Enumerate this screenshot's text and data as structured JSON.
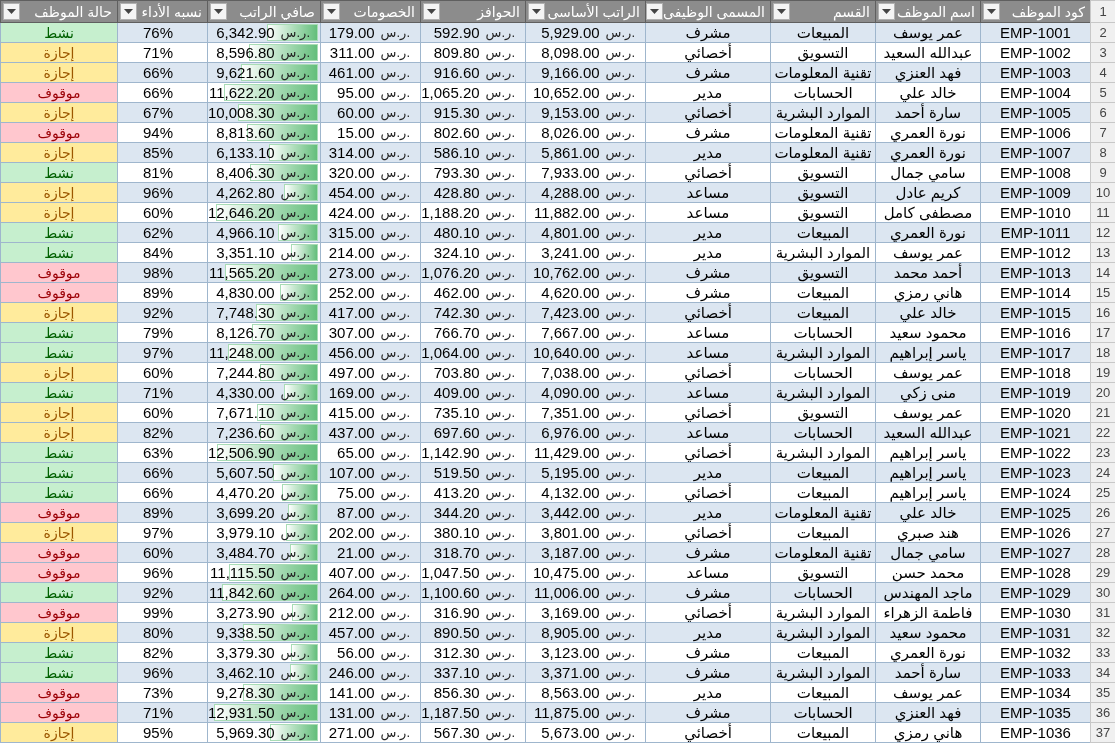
{
  "sheet": {
    "header_row_number": "1",
    "columns": [
      "كود الموظف",
      "اسم الموظف",
      "القسم",
      "المسمى الوظيفى",
      "الراتب الأساسى",
      "الحوافز",
      "الخصومات",
      "صافي الراتب",
      "نسبه الأداء",
      "حالة الموظف"
    ],
    "rows": [
      {
        "row_number": "2",
        "code": "EMP-1001",
        "name": "عمر يوسف",
        "department": "المبيعات",
        "job_title": "مشرف",
        "base_salary": {
          "currency": "ر.س.",
          "amount": "5,929.00"
        },
        "bonus": {
          "currency": "ر.س.",
          "amount": "592.90"
        },
        "deductions": {
          "currency": "ر.س.",
          "amount": "179.00"
        },
        "net_salary": {
          "currency": "ر.س.",
          "amount": "6,342.90",
          "level": 0.49
        },
        "performance": "76%",
        "status": {
          "text": "نشط",
          "color": "#c6efce"
        }
      },
      {
        "row_number": "3",
        "code": "EMP-1002",
        "name": "عبدالله السعيد",
        "department": "التسويق",
        "job_title": "أخصائي",
        "base_salary": {
          "currency": "ر.س.",
          "amount": "8,098.00"
        },
        "bonus": {
          "currency": "ر.س.",
          "amount": "809.80"
        },
        "deductions": {
          "currency": "ر.س.",
          "amount": "311.00"
        },
        "net_salary": {
          "currency": "ر.س.",
          "amount": "8,596.80",
          "level": 0.66
        },
        "performance": "71%",
        "status": {
          "text": "إجازة",
          "color": "#ffeb9c"
        }
      },
      {
        "row_number": "4",
        "code": "EMP-1003",
        "name": "فهد العنزي",
        "department": "تقنية المعلومات",
        "job_title": "مشرف",
        "base_salary": {
          "currency": "ر.س.",
          "amount": "9,166.00"
        },
        "bonus": {
          "currency": "ر.س.",
          "amount": "916.60"
        },
        "deductions": {
          "currency": "ر.س.",
          "amount": "461.00"
        },
        "net_salary": {
          "currency": "ر.س.",
          "amount": "9,621.60",
          "level": 0.74
        },
        "performance": "66%",
        "status": {
          "text": "إجازة",
          "color": "#ffeb9c"
        }
      },
      {
        "row_number": "5",
        "code": "EMP-1004",
        "name": "خالد علي",
        "department": "الحسابات",
        "job_title": "مدير",
        "base_salary": {
          "currency": "ر.س.",
          "amount": "10,652.00"
        },
        "bonus": {
          "currency": "ر.س.",
          "amount": "1,065.20"
        },
        "deductions": {
          "currency": "ر.س.",
          "amount": "95.00"
        },
        "net_salary": {
          "currency": "ر.س.",
          "amount": "11,622.20",
          "level": 0.9
        },
        "performance": "66%",
        "status": {
          "text": "موقوف",
          "color": "#ffc7ce"
        }
      },
      {
        "row_number": "6",
        "code": "EMP-1005",
        "name": "سارة أحمد",
        "department": "الموارد البشرية",
        "job_title": "أخصائي",
        "base_salary": {
          "currency": "ر.س.",
          "amount": "9,153.00"
        },
        "bonus": {
          "currency": "ر.س.",
          "amount": "915.30"
        },
        "deductions": {
          "currency": "ر.س.",
          "amount": "60.00"
        },
        "net_salary": {
          "currency": "ر.س.",
          "amount": "10,008.30",
          "level": 0.77
        },
        "performance": "67%",
        "status": {
          "text": "إجازة",
          "color": "#ffeb9c"
        }
      },
      {
        "row_number": "7",
        "code": "EMP-1006",
        "name": "نورة العمري",
        "department": "تقنية المعلومات",
        "job_title": "مشرف",
        "base_salary": {
          "currency": "ر.س.",
          "amount": "8,026.00"
        },
        "bonus": {
          "currency": "ر.س.",
          "amount": "802.60"
        },
        "deductions": {
          "currency": "ر.س.",
          "amount": "15.00"
        },
        "net_salary": {
          "currency": "ر.س.",
          "amount": "8,813.60",
          "level": 0.68
        },
        "performance": "94%",
        "status": {
          "text": "موقوف",
          "color": "#ffc7ce"
        }
      },
      {
        "row_number": "8",
        "code": "EMP-1007",
        "name": "نورة العمري",
        "department": "تقنية المعلومات",
        "job_title": "مدير",
        "base_salary": {
          "currency": "ر.س.",
          "amount": "5,861.00"
        },
        "bonus": {
          "currency": "ر.س.",
          "amount": "586.10"
        },
        "deductions": {
          "currency": "ر.س.",
          "amount": "314.00"
        },
        "net_salary": {
          "currency": "ر.س.",
          "amount": "6,133.10",
          "level": 0.47
        },
        "performance": "85%",
        "status": {
          "text": "إجازة",
          "color": "#ffeb9c"
        }
      },
      {
        "row_number": "9",
        "code": "EMP-1008",
        "name": "سامي جمال",
        "department": "التسويق",
        "job_title": "أخصائي",
        "base_salary": {
          "currency": "ر.س.",
          "amount": "7,933.00"
        },
        "bonus": {
          "currency": "ر.س.",
          "amount": "793.30"
        },
        "deductions": {
          "currency": "ر.س.",
          "amount": "320.00"
        },
        "net_salary": {
          "currency": "ر.س.",
          "amount": "8,406.30",
          "level": 0.65
        },
        "performance": "81%",
        "status": {
          "text": "نشط",
          "color": "#c6efce"
        }
      },
      {
        "row_number": "10",
        "code": "EMP-1009",
        "name": "كريم عادل",
        "department": "التسويق",
        "job_title": "مساعد",
        "base_salary": {
          "currency": "ر.س.",
          "amount": "4,288.00"
        },
        "bonus": {
          "currency": "ر.س.",
          "amount": "428.80"
        },
        "deductions": {
          "currency": "ر.س.",
          "amount": "454.00"
        },
        "net_salary": {
          "currency": "ر.س.",
          "amount": "4,262.80",
          "level": 0.33
        },
        "performance": "96%",
        "status": {
          "text": "إجازة",
          "color": "#ffeb9c"
        }
      },
      {
        "row_number": "11",
        "code": "EMP-1010",
        "name": "مصطفى كامل",
        "department": "التسويق",
        "job_title": "مساعد",
        "base_salary": {
          "currency": "ر.س.",
          "amount": "11,882.00"
        },
        "bonus": {
          "currency": "ر.س.",
          "amount": "1,188.20"
        },
        "deductions": {
          "currency": "ر.س.",
          "amount": "424.00"
        },
        "net_salary": {
          "currency": "ر.س.",
          "amount": "12,646.20",
          "level": 0.98
        },
        "performance": "60%",
        "status": {
          "text": "إجازة",
          "color": "#ffeb9c"
        }
      },
      {
        "row_number": "12",
        "code": "EMP-1011",
        "name": "نورة العمري",
        "department": "المبيعات",
        "job_title": "مدير",
        "base_salary": {
          "currency": "ر.س.",
          "amount": "4,801.00"
        },
        "bonus": {
          "currency": "ر.س.",
          "amount": "480.10"
        },
        "deductions": {
          "currency": "ر.س.",
          "amount": "315.00"
        },
        "net_salary": {
          "currency": "ر.س.",
          "amount": "4,966.10",
          "level": 0.38
        },
        "performance": "62%",
        "status": {
          "text": "نشط",
          "color": "#c6efce"
        }
      },
      {
        "row_number": "13",
        "code": "EMP-1012",
        "name": "عمر يوسف",
        "department": "الموارد البشرية",
        "job_title": "مدير",
        "base_salary": {
          "currency": "ر.س.",
          "amount": "3,241.00"
        },
        "bonus": {
          "currency": "ر.س.",
          "amount": "324.10"
        },
        "deductions": {
          "currency": "ر.س.",
          "amount": "214.00"
        },
        "net_salary": {
          "currency": "ر.س.",
          "amount": "3,351.10",
          "level": 0.26
        },
        "performance": "84%",
        "status": {
          "text": "نشط",
          "color": "#c6efce"
        }
      },
      {
        "row_number": "14",
        "code": "EMP-1013",
        "name": "أحمد محمد",
        "department": "التسويق",
        "job_title": "مشرف",
        "base_salary": {
          "currency": "ر.س.",
          "amount": "10,762.00"
        },
        "bonus": {
          "currency": "ر.س.",
          "amount": "1,076.20"
        },
        "deductions": {
          "currency": "ر.س.",
          "amount": "273.00"
        },
        "net_salary": {
          "currency": "ر.س.",
          "amount": "11,565.20",
          "level": 0.89
        },
        "performance": "98%",
        "status": {
          "text": "موقوف",
          "color": "#ffc7ce"
        }
      },
      {
        "row_number": "15",
        "code": "EMP-1014",
        "name": "هاني رمزي",
        "department": "المبيعات",
        "job_title": "مشرف",
        "base_salary": {
          "currency": "ر.س.",
          "amount": "4,620.00"
        },
        "bonus": {
          "currency": "ر.س.",
          "amount": "462.00"
        },
        "deductions": {
          "currency": "ر.س.",
          "amount": "252.00"
        },
        "net_salary": {
          "currency": "ر.س.",
          "amount": "4,830.00",
          "level": 0.37
        },
        "performance": "89%",
        "status": {
          "text": "موقوف",
          "color": "#ffc7ce"
        }
      },
      {
        "row_number": "16",
        "code": "EMP-1015",
        "name": "خالد علي",
        "department": "المبيعات",
        "job_title": "أخصائي",
        "base_salary": {
          "currency": "ر.س.",
          "amount": "7,423.00"
        },
        "bonus": {
          "currency": "ر.س.",
          "amount": "742.30"
        },
        "deductions": {
          "currency": "ر.س.",
          "amount": "417.00"
        },
        "net_salary": {
          "currency": "ر.س.",
          "amount": "7,748.30",
          "level": 0.6
        },
        "performance": "92%",
        "status": {
          "text": "إجازة",
          "color": "#ffeb9c"
        }
      },
      {
        "row_number": "17",
        "code": "EMP-1016",
        "name": "محمود سعيد",
        "department": "الحسابات",
        "job_title": "مساعد",
        "base_salary": {
          "currency": "ر.س.",
          "amount": "7,667.00"
        },
        "bonus": {
          "currency": "ر.س.",
          "amount": "766.70"
        },
        "deductions": {
          "currency": "ر.س.",
          "amount": "307.00"
        },
        "net_salary": {
          "currency": "ر.س.",
          "amount": "8,126.70",
          "level": 0.63
        },
        "performance": "79%",
        "status": {
          "text": "نشط",
          "color": "#c6efce"
        }
      },
      {
        "row_number": "18",
        "code": "EMP-1017",
        "name": "ياسر إبراهيم",
        "department": "الموارد البشرية",
        "job_title": "مساعد",
        "base_salary": {
          "currency": "ر.س.",
          "amount": "10,640.00"
        },
        "bonus": {
          "currency": "ر.س.",
          "amount": "1,064.00"
        },
        "deductions": {
          "currency": "ر.س.",
          "amount": "456.00"
        },
        "net_salary": {
          "currency": "ر.س.",
          "amount": "11,248.00",
          "level": 0.87
        },
        "performance": "97%",
        "status": {
          "text": "نشط",
          "color": "#c6efce"
        }
      },
      {
        "row_number": "19",
        "code": "EMP-1018",
        "name": "عمر يوسف",
        "department": "الحسابات",
        "job_title": "أخصائي",
        "base_salary": {
          "currency": "ر.س.",
          "amount": "7,038.00"
        },
        "bonus": {
          "currency": "ر.س.",
          "amount": "703.80"
        },
        "deductions": {
          "currency": "ر.س.",
          "amount": "497.00"
        },
        "net_salary": {
          "currency": "ر.س.",
          "amount": "7,244.80",
          "level": 0.56
        },
        "performance": "60%",
        "status": {
          "text": "إجازة",
          "color": "#ffeb9c"
        }
      },
      {
        "row_number": "20",
        "code": "EMP-1019",
        "name": "منى زكي",
        "department": "الموارد البشرية",
        "job_title": "مساعد",
        "base_salary": {
          "currency": "ر.س.",
          "amount": "4,090.00"
        },
        "bonus": {
          "currency": "ر.س.",
          "amount": "409.00"
        },
        "deductions": {
          "currency": "ر.س.",
          "amount": "169.00"
        },
        "net_salary": {
          "currency": "ر.س.",
          "amount": "4,330.00",
          "level": 0.33
        },
        "performance": "71%",
        "status": {
          "text": "نشط",
          "color": "#c6efce"
        }
      },
      {
        "row_number": "21",
        "code": "EMP-1020",
        "name": "عمر يوسف",
        "department": "التسويق",
        "job_title": "أخصائي",
        "base_salary": {
          "currency": "ر.س.",
          "amount": "7,351.00"
        },
        "bonus": {
          "currency": "ر.س.",
          "amount": "735.10"
        },
        "deductions": {
          "currency": "ر.س.",
          "amount": "415.00"
        },
        "net_salary": {
          "currency": "ر.س.",
          "amount": "7,671.10",
          "level": 0.59
        },
        "performance": "60%",
        "status": {
          "text": "إجازة",
          "color": "#ffeb9c"
        }
      },
      {
        "row_number": "22",
        "code": "EMP-1021",
        "name": "عبدالله السعيد",
        "department": "الحسابات",
        "job_title": "مساعد",
        "base_salary": {
          "currency": "ر.س.",
          "amount": "6,976.00"
        },
        "bonus": {
          "currency": "ر.س.",
          "amount": "697.60"
        },
        "deductions": {
          "currency": "ر.س.",
          "amount": "437.00"
        },
        "net_salary": {
          "currency": "ر.س.",
          "amount": "7,236.60",
          "level": 0.56
        },
        "performance": "82%",
        "status": {
          "text": "إجازة",
          "color": "#ffeb9c"
        }
      },
      {
        "row_number": "23",
        "code": "EMP-1022",
        "name": "ياسر إبراهيم",
        "department": "الموارد البشرية",
        "job_title": "أخصائي",
        "base_salary": {
          "currency": "ر.س.",
          "amount": "11,429.00"
        },
        "bonus": {
          "currency": "ر.س.",
          "amount": "1,142.90"
        },
        "deductions": {
          "currency": "ر.س.",
          "amount": "65.00"
        },
        "net_salary": {
          "currency": "ر.س.",
          "amount": "12,506.90",
          "level": 0.97
        },
        "performance": "63%",
        "status": {
          "text": "نشط",
          "color": "#c6efce"
        }
      },
      {
        "row_number": "24",
        "code": "EMP-1023",
        "name": "ياسر إبراهيم",
        "department": "المبيعات",
        "job_title": "مدير",
        "base_salary": {
          "currency": "ر.س.",
          "amount": "5,195.00"
        },
        "bonus": {
          "currency": "ر.س.",
          "amount": "519.50"
        },
        "deductions": {
          "currency": "ر.س.",
          "amount": "107.00"
        },
        "net_salary": {
          "currency": "ر.س.",
          "amount": "5,607.50",
          "level": 0.43
        },
        "performance": "66%",
        "status": {
          "text": "نشط",
          "color": "#c6efce"
        }
      },
      {
        "row_number": "25",
        "code": "EMP-1024",
        "name": "ياسر إبراهيم",
        "department": "المبيعات",
        "job_title": "أخصائي",
        "base_salary": {
          "currency": "ر.س.",
          "amount": "4,132.00"
        },
        "bonus": {
          "currency": "ر.س.",
          "amount": "413.20"
        },
        "deductions": {
          "currency": "ر.س.",
          "amount": "75.00"
        },
        "net_salary": {
          "currency": "ر.س.",
          "amount": "4,470.20",
          "level": 0.35
        },
        "performance": "66%",
        "status": {
          "text": "نشط",
          "color": "#c6efce"
        }
      },
      {
        "row_number": "26",
        "code": "EMP-1025",
        "name": "خالد علي",
        "department": "تقنية المعلومات",
        "job_title": "مدير",
        "base_salary": {
          "currency": "ر.س.",
          "amount": "3,442.00"
        },
        "bonus": {
          "currency": "ر.س.",
          "amount": "344.20"
        },
        "deductions": {
          "currency": "ر.س.",
          "amount": "87.00"
        },
        "net_salary": {
          "currency": "ر.س.",
          "amount": "3,699.20",
          "level": 0.29
        },
        "performance": "89%",
        "status": {
          "text": "موقوف",
          "color": "#ffc7ce"
        }
      },
      {
        "row_number": "27",
        "code": "EMP-1026",
        "name": "هند صبري",
        "department": "المبيعات",
        "job_title": "أخصائي",
        "base_salary": {
          "currency": "ر.س.",
          "amount": "3,801.00"
        },
        "bonus": {
          "currency": "ر.س.",
          "amount": "380.10"
        },
        "deductions": {
          "currency": "ر.س.",
          "amount": "202.00"
        },
        "net_salary": {
          "currency": "ر.س.",
          "amount": "3,979.10",
          "level": 0.31
        },
        "performance": "97%",
        "status": {
          "text": "إجازة",
          "color": "#ffeb9c"
        }
      },
      {
        "row_number": "28",
        "code": "EMP-1027",
        "name": "سامي جمال",
        "department": "تقنية المعلومات",
        "job_title": "مشرف",
        "base_salary": {
          "currency": "ر.س.",
          "amount": "3,187.00"
        },
        "bonus": {
          "currency": "ر.س.",
          "amount": "318.70"
        },
        "deductions": {
          "currency": "ر.س.",
          "amount": "21.00"
        },
        "net_salary": {
          "currency": "ر.س.",
          "amount": "3,484.70",
          "level": 0.27
        },
        "performance": "60%",
        "status": {
          "text": "موقوف",
          "color": "#ffc7ce"
        }
      },
      {
        "row_number": "29",
        "code": "EMP-1028",
        "name": "محمد حسن",
        "department": "التسويق",
        "job_title": "مساعد",
        "base_salary": {
          "currency": "ر.س.",
          "amount": "10,475.00"
        },
        "bonus": {
          "currency": "ر.س.",
          "amount": "1,047.50"
        },
        "deductions": {
          "currency": "ر.س.",
          "amount": "407.00"
        },
        "net_salary": {
          "currency": "ر.س.",
          "amount": "11,115.50",
          "level": 0.86
        },
        "performance": "96%",
        "status": {
          "text": "موقوف",
          "color": "#ffc7ce"
        }
      },
      {
        "row_number": "30",
        "code": "EMP-1029",
        "name": "ماجد المهندس",
        "department": "الحسابات",
        "job_title": "مشرف",
        "base_salary": {
          "currency": "ر.س.",
          "amount": "11,006.00"
        },
        "bonus": {
          "currency": "ر.س.",
          "amount": "1,100.60"
        },
        "deductions": {
          "currency": "ر.س.",
          "amount": "264.00"
        },
        "net_salary": {
          "currency": "ر.س.",
          "amount": "11,842.60",
          "level": 0.92
        },
        "performance": "92%",
        "status": {
          "text": "نشط",
          "color": "#c6efce"
        }
      },
      {
        "row_number": "31",
        "code": "EMP-1030",
        "name": "فاطمة الزهراء",
        "department": "الموارد البشرية",
        "job_title": "أخصائي",
        "base_salary": {
          "currency": "ر.س.",
          "amount": "3,169.00"
        },
        "bonus": {
          "currency": "ر.س.",
          "amount": "316.90"
        },
        "deductions": {
          "currency": "ر.س.",
          "amount": "212.00"
        },
        "net_salary": {
          "currency": "ر.س.",
          "amount": "3,273.90",
          "level": 0.25
        },
        "performance": "99%",
        "status": {
          "text": "موقوف",
          "color": "#ffc7ce"
        }
      },
      {
        "row_number": "32",
        "code": "EMP-1031",
        "name": "محمود سعيد",
        "department": "الموارد البشرية",
        "job_title": "مدير",
        "base_salary": {
          "currency": "ر.س.",
          "amount": "8,905.00"
        },
        "bonus": {
          "currency": "ر.س.",
          "amount": "890.50"
        },
        "deductions": {
          "currency": "ر.س.",
          "amount": "457.00"
        },
        "net_salary": {
          "currency": "ر.س.",
          "amount": "9,338.50",
          "level": 0.72
        },
        "performance": "80%",
        "status": {
          "text": "إجازة",
          "color": "#ffeb9c"
        }
      },
      {
        "row_number": "33",
        "code": "EMP-1032",
        "name": "نورة العمري",
        "department": "المبيعات",
        "job_title": "مشرف",
        "base_salary": {
          "currency": "ر.س.",
          "amount": "3,123.00"
        },
        "bonus": {
          "currency": "ر.س.",
          "amount": "312.30"
        },
        "deductions": {
          "currency": "ر.س.",
          "amount": "56.00"
        },
        "net_salary": {
          "currency": "ر.س.",
          "amount": "3,379.30",
          "level": 0.26
        },
        "performance": "82%",
        "status": {
          "text": "نشط",
          "color": "#c6efce"
        }
      },
      {
        "row_number": "34",
        "code": "EMP-1033",
        "name": "سارة أحمد",
        "department": "الموارد البشرية",
        "job_title": "مشرف",
        "base_salary": {
          "currency": "ر.س.",
          "amount": "3,371.00"
        },
        "bonus": {
          "currency": "ر.س.",
          "amount": "337.10"
        },
        "deductions": {
          "currency": "ر.س.",
          "amount": "246.00"
        },
        "net_salary": {
          "currency": "ر.س.",
          "amount": "3,462.10",
          "level": 0.27
        },
        "performance": "96%",
        "status": {
          "text": "نشط",
          "color": "#c6efce"
        }
      },
      {
        "row_number": "35",
        "code": "EMP-1034",
        "name": "عمر يوسف",
        "department": "المبيعات",
        "job_title": "مدير",
        "base_salary": {
          "currency": "ر.س.",
          "amount": "8,563.00"
        },
        "bonus": {
          "currency": "ر.س.",
          "amount": "856.30"
        },
        "deductions": {
          "currency": "ر.س.",
          "amount": "141.00"
        },
        "net_salary": {
          "currency": "ر.س.",
          "amount": "9,278.30",
          "level": 0.72
        },
        "performance": "73%",
        "status": {
          "text": "موقوف",
          "color": "#ffc7ce"
        }
      },
      {
        "row_number": "36",
        "code": "EMP-1035",
        "name": "فهد العنزي",
        "department": "الحسابات",
        "job_title": "مشرف",
        "base_salary": {
          "currency": "ر.س.",
          "amount": "11,875.00"
        },
        "bonus": {
          "currency": "ر.س.",
          "amount": "1,187.50"
        },
        "deductions": {
          "currency": "ر.س.",
          "amount": "131.00"
        },
        "net_salary": {
          "currency": "ر.س.",
          "amount": "12,931.50",
          "level": 1.0
        },
        "performance": "71%",
        "status": {
          "text": "موقوف",
          "color": "#ffc7ce"
        }
      },
      {
        "row_number": "37",
        "code": "EMP-1036",
        "name": "هاني رمزي",
        "department": "المبيعات",
        "job_title": "أخصائي",
        "base_salary": {
          "currency": "ر.س.",
          "amount": "5,673.00"
        },
        "bonus": {
          "currency": "ر.س.",
          "amount": "567.30"
        },
        "deductions": {
          "currency": "ر.س.",
          "amount": "271.00"
        },
        "net_salary": {
          "currency": "ر.س.",
          "amount": "5,969.30",
          "level": 0.46
        },
        "performance": "95%",
        "status": {
          "text": "إجازة",
          "color": "#ffeb9c"
        }
      }
    ]
  }
}
